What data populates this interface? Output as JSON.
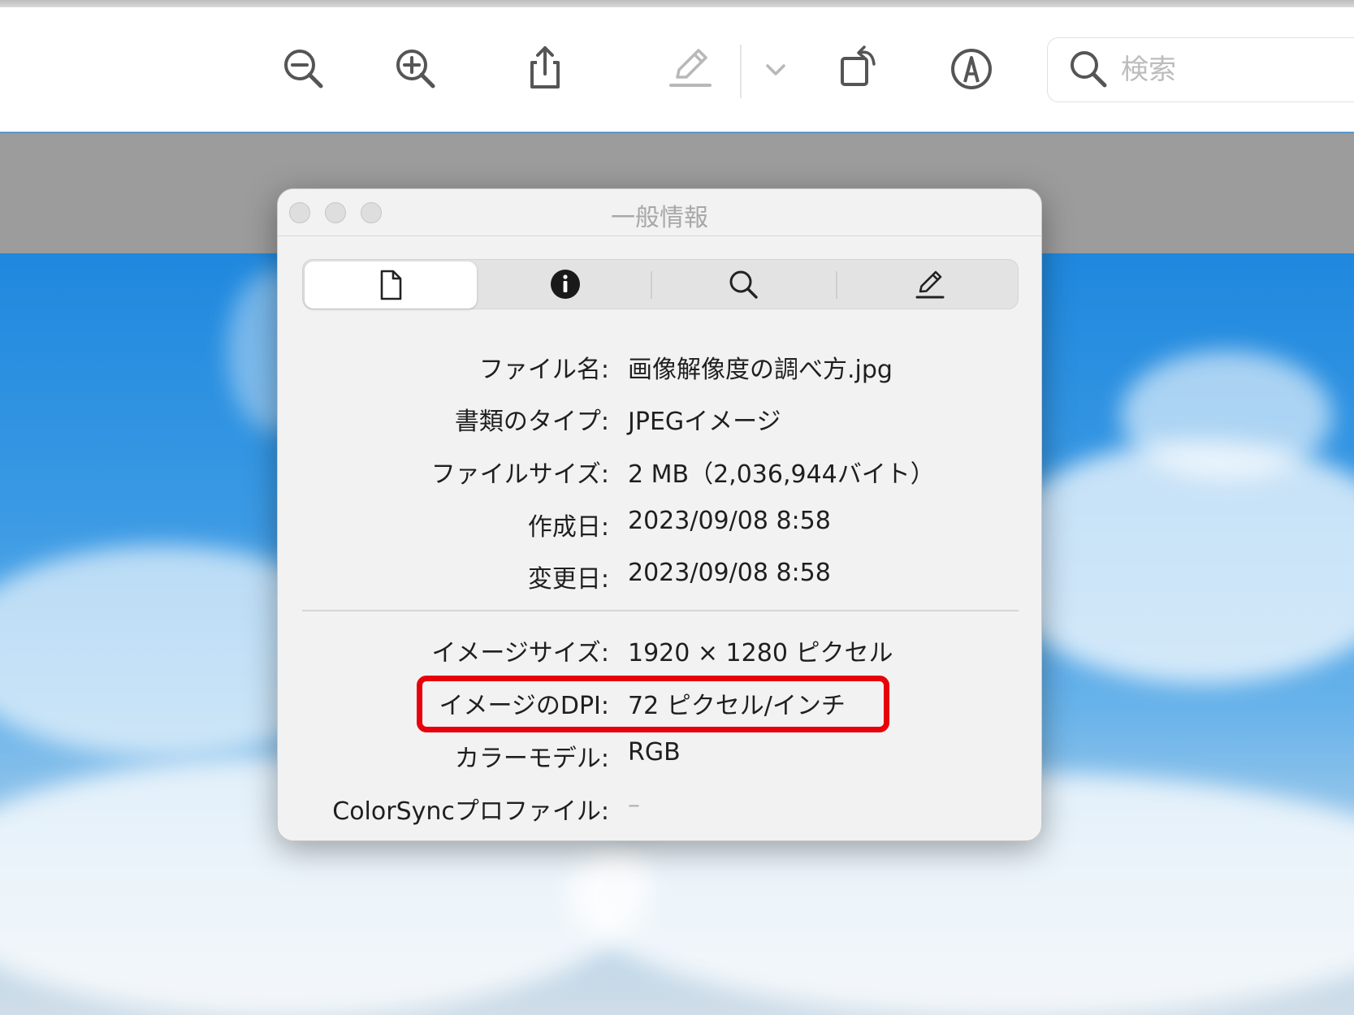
{
  "toolbar": {
    "icons": [
      "zoom-out-icon",
      "zoom-in-icon",
      "share-icon",
      "markup-pen-icon",
      "chevron-down-icon",
      "rotate-icon",
      "annotate-icon"
    ],
    "search_placeholder": "検索"
  },
  "inspector": {
    "title": "一般情報",
    "tabs": [
      {
        "icon": "document-icon",
        "selected": true
      },
      {
        "icon": "info-icon",
        "selected": false
      },
      {
        "icon": "search-icon",
        "selected": false
      },
      {
        "icon": "pencil-icon",
        "selected": false
      }
    ],
    "general": [
      {
        "label": "ファイル名:",
        "value": "画像解像度の調べ方.jpg"
      },
      {
        "label": "書類のタイプ:",
        "value": "JPEGイメージ"
      },
      {
        "label": "ファイルサイズ:",
        "value": "2 MB（2,036,944バイト）"
      },
      {
        "label": "作成日:",
        "value": "2023/09/08 8:58"
      },
      {
        "label": "変更日:",
        "value": "2023/09/08 8:58"
      }
    ],
    "image": [
      {
        "label": "イメージサイズ:",
        "value": "1920 × 1280 ピクセル"
      },
      {
        "label": "イメージのDPI:",
        "value": "72 ピクセル/インチ"
      },
      {
        "label": "カラーモデル:",
        "value": "RGB"
      },
      {
        "label": "ColorSyncプロファイル:",
        "value": "–"
      }
    ]
  },
  "colors": {
    "highlight": "#e8000b",
    "sky": "#2f8fdc"
  }
}
